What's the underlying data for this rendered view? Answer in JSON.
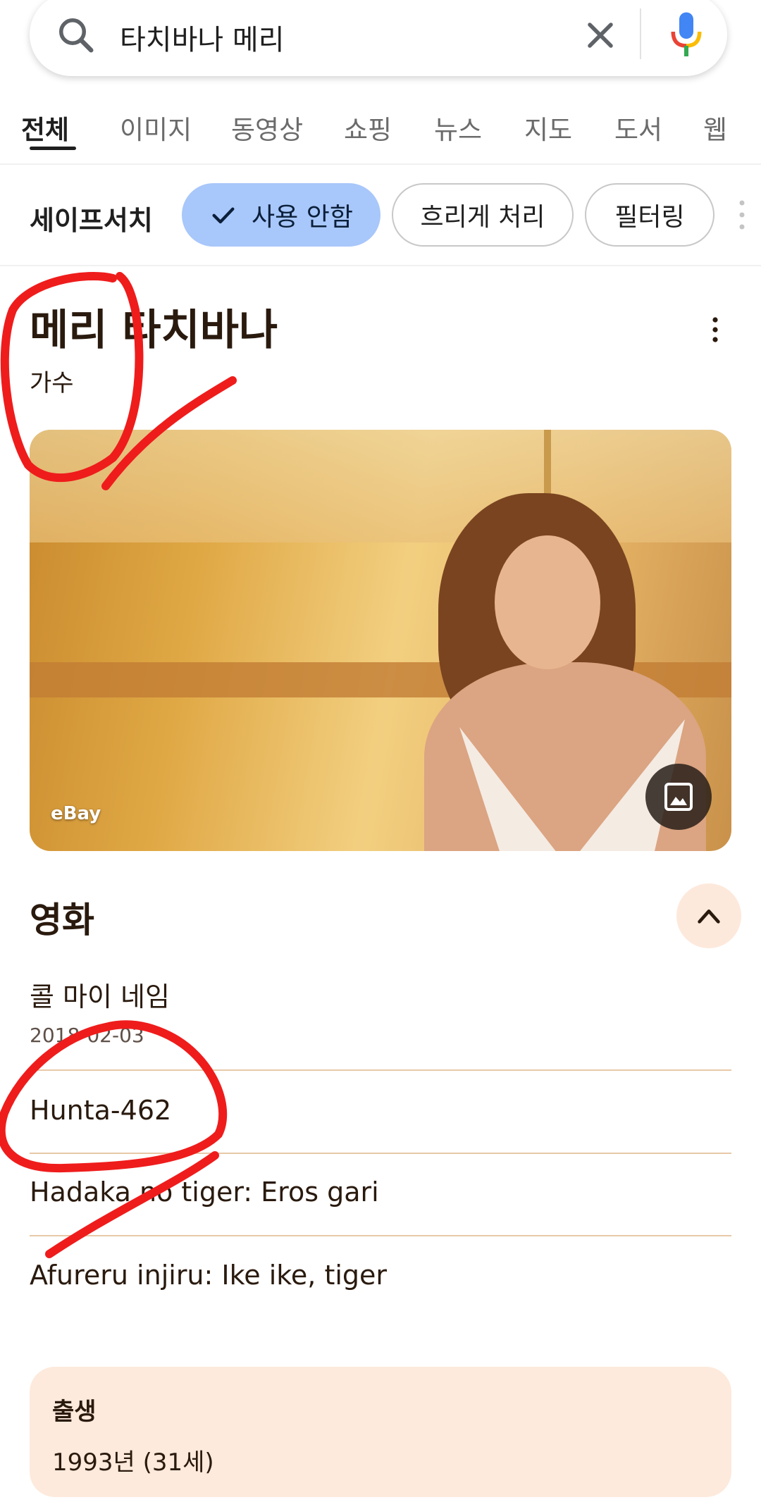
{
  "search": {
    "query": "타치바나 메리"
  },
  "tabs": [
    {
      "label": "전체",
      "active": true
    },
    {
      "label": "이미지"
    },
    {
      "label": "동영상"
    },
    {
      "label": "쇼핑"
    },
    {
      "label": "뉴스"
    },
    {
      "label": "지도"
    },
    {
      "label": "도서"
    },
    {
      "label": "웹"
    }
  ],
  "safesearch": {
    "label": "세이프서치",
    "options": [
      {
        "label": "사용 안함",
        "selected": true
      },
      {
        "label": "흐리게 처리"
      },
      {
        "label": "필터링"
      }
    ]
  },
  "knowledge_panel": {
    "title": "메리 타치바나",
    "subtitle": "가수",
    "image_source": "eBay"
  },
  "movies": {
    "heading": "영화",
    "items": [
      {
        "title": "콜 마이 네임",
        "date": "2018-02-03"
      },
      {
        "title": "Hunta-462"
      },
      {
        "title": "Hadaka no tiger: Eros gari"
      },
      {
        "title": "Afureru injiru: Ike ike, tiger"
      }
    ]
  },
  "born": {
    "label": "출생",
    "value": "1993년 (31세)"
  },
  "colors": {
    "chip_selected": "#a8c7fa",
    "accent_bg": "#fdeadc",
    "annotation_red": "#ef1c1c"
  }
}
